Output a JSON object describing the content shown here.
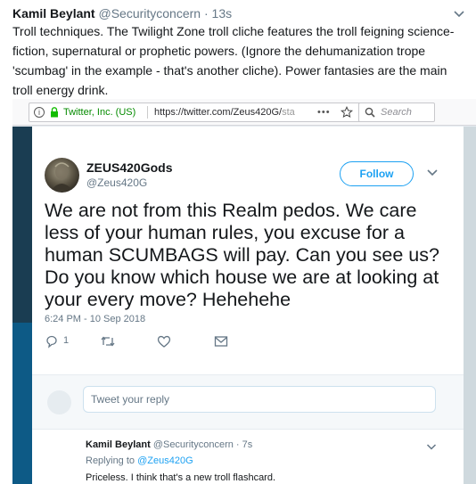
{
  "outer_tweet": {
    "name": "Kamil Beylant",
    "handle": "@Securityconcern",
    "separator": "·",
    "time": "13s",
    "text": "Troll techniques.  The Twilight Zone troll cliche features the troll feigning science-fiction, supernatural or prophetic powers.  (Ignore the dehumanization trope 'scumbag' in the example - that's another cliche).  Power fantasies are the main troll energy drink."
  },
  "browser": {
    "info_glyph": "i",
    "org": "Twitter, Inc. (US)",
    "url": "https://twitter.com/Zeus420G/",
    "url_faded": "sta",
    "more": "•••",
    "search_placeholder": "Search"
  },
  "embedded_tweet": {
    "display_name": "ZEUS420Gods",
    "username": "@Zeus420G",
    "follow_label": "Follow",
    "text": "We are not from this Realm pedos. We care less of your human rules, you excuse for a human SCUMBAGS will pay. Can you see us? Do you know which house we are at looking at your every move? Hehehehe",
    "timestamp": "6:24 PM - 10 Sep 2018",
    "reply_count": "1"
  },
  "reply_box": {
    "placeholder": "Tweet your reply"
  },
  "reply_tweet": {
    "name": "Kamil Beylant",
    "handle": "@Securityconcern",
    "separator": "·",
    "time": "7s",
    "replying_prefix": "Replying to",
    "replying_to": "@Zeus420G",
    "text": "Priceless.  I think that's a new troll flashcard."
  },
  "colors": {
    "accent": "#1da1f2",
    "muted": "#657786",
    "text": "#14171a",
    "secure_green": "#058b00"
  },
  "icons": {
    "outer_menu": "chevron-down-icon",
    "lock": "lock-icon",
    "star": "star-icon",
    "search": "search-icon",
    "reply": "reply-icon",
    "retweet": "retweet-icon",
    "like": "heart-icon",
    "dm": "envelope-icon"
  }
}
